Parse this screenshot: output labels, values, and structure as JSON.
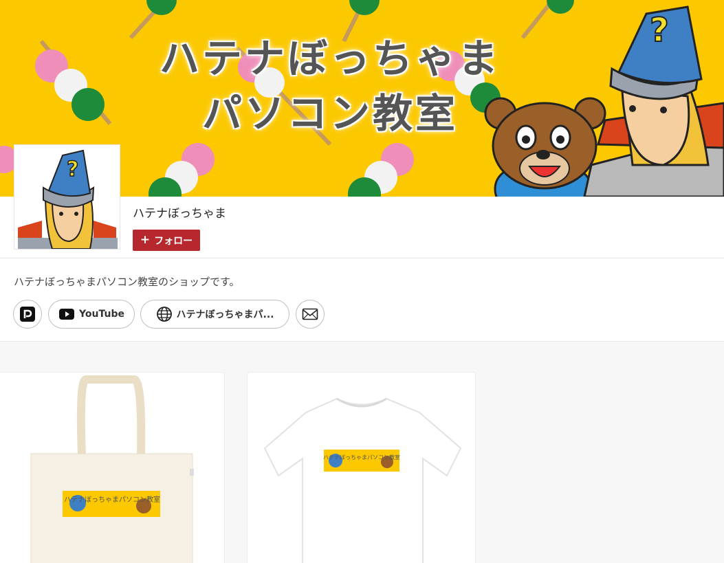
{
  "banner": {
    "title_line1": "ハテナぼっちゃま",
    "title_line2": "パソコン教室"
  },
  "profile": {
    "name": "ハテナぼっちゃま",
    "follow_label": "フォロー",
    "follow_icon": "plus-icon",
    "description": "ハテナぼっちゃまパソコン教室のショップです。"
  },
  "links": [
    {
      "icon": "pixiv-icon",
      "label": ""
    },
    {
      "icon": "youtube-icon",
      "label": "YouTube"
    },
    {
      "icon": "globe-icon",
      "label": "ハテナぼっちゃまパ..."
    },
    {
      "icon": "mail-icon",
      "label": ""
    }
  ],
  "products": [
    {
      "type": "tote-bag",
      "print_text": "ハテナぼっちゃまパソコン教室"
    },
    {
      "type": "t-shirt",
      "print_text": "ハテナぼっちゃまパソコン教室"
    }
  ],
  "colors": {
    "banner_bg": "#fcc800",
    "follow_button": "#b7282e",
    "page_bg": "#f7f7f7"
  }
}
